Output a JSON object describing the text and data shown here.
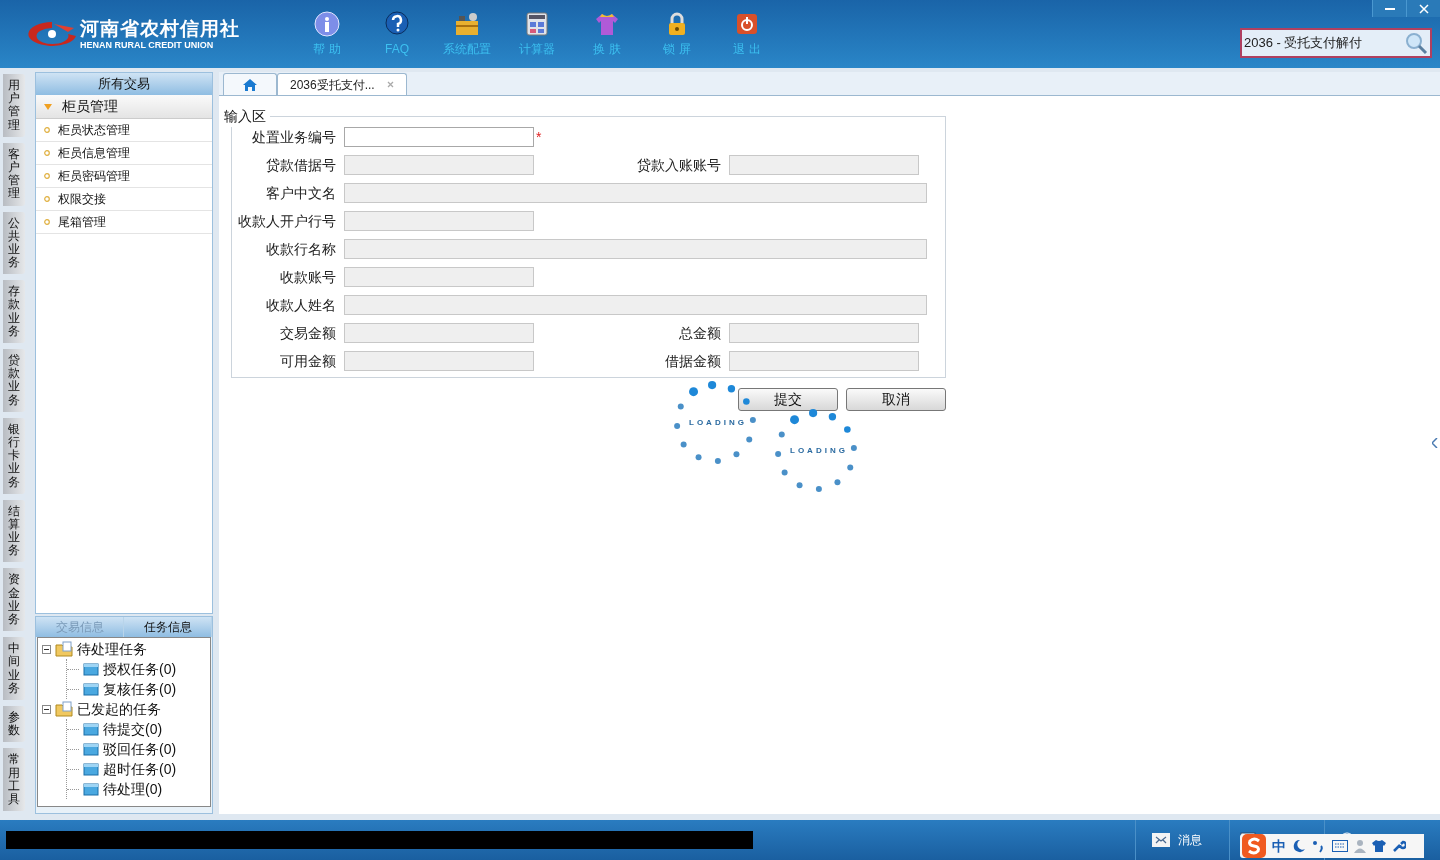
{
  "header": {
    "logo_cn": "河南省农村信用社",
    "logo_en": "HENAN RURAL CREDIT UNION",
    "toolbar": [
      {
        "kind": "info",
        "label": "帮 助"
      },
      {
        "kind": "faq",
        "label": "FAQ"
      },
      {
        "kind": "config",
        "label": "系统配置"
      },
      {
        "kind": "calc",
        "label": "计算器"
      },
      {
        "kind": "skin",
        "label": "换 肤"
      },
      {
        "kind": "lock",
        "label": "锁 屏"
      },
      {
        "kind": "exit",
        "label": "退 出"
      }
    ],
    "search": {
      "value": "2036 - 受托支付解付"
    }
  },
  "side_tabs": [
    {
      "label": "用户管理"
    },
    {
      "label": "客户管理"
    },
    {
      "label": "公共业务"
    },
    {
      "label": "存款业务"
    },
    {
      "label": "贷款业务"
    },
    {
      "label": "银行卡业务"
    },
    {
      "label": "结算业务"
    },
    {
      "label": "资金业务"
    },
    {
      "label": "中间业务"
    },
    {
      "label": "参数"
    },
    {
      "label": "常用工具"
    }
  ],
  "menu": {
    "title": "所有交易",
    "group": {
      "label": "柜员管理",
      "expanded": true
    },
    "items": [
      "柜员状态管理",
      "柜员信息管理",
      "柜员密码管理",
      "权限交接",
      "尾箱管理"
    ]
  },
  "info_tabs": [
    {
      "label": "交易信息",
      "selected": false
    },
    {
      "label": "任务信息",
      "selected": true
    }
  ],
  "tree": [
    {
      "label": "待处理任务",
      "expanded": true,
      "children": [
        {
          "label": "授权任务(0)"
        },
        {
          "label": "复核任务(0)"
        }
      ]
    },
    {
      "label": "已发起的任务",
      "expanded": true,
      "children": [
        {
          "label": "待提交(0)"
        },
        {
          "label": "驳回任务(0)"
        },
        {
          "label": "超时任务(0)"
        },
        {
          "label": "待处理(0)"
        }
      ]
    }
  ],
  "doc_tabs": [
    {
      "kind": "home",
      "selected": false
    },
    {
      "kind": "page",
      "label": "2036受托支付...",
      "selected": true
    }
  ],
  "form": {
    "legend": "输入区",
    "rows": [
      [
        {
          "label": "处置业务编号",
          "kind": "short",
          "disabled": false,
          "required_mark": "*"
        }
      ],
      [
        {
          "label": "贷款借据号",
          "kind": "short",
          "disabled": true
        },
        {
          "label": "贷款入账账号",
          "kind": "short",
          "disabled": true
        }
      ],
      [
        {
          "label": "客户中文名",
          "kind": "long",
          "disabled": true
        }
      ],
      [
        {
          "label": "收款人开户行号",
          "kind": "short",
          "disabled": true
        }
      ],
      [
        {
          "label": "收款行名称",
          "kind": "long",
          "disabled": true
        }
      ],
      [
        {
          "label": "收款账号",
          "kind": "short",
          "disabled": true
        }
      ],
      [
        {
          "label": "收款人姓名",
          "kind": "long",
          "disabled": true
        }
      ],
      [
        {
          "label": "交易金额",
          "kind": "short",
          "disabled": true
        },
        {
          "label": "总金额",
          "kind": "short",
          "disabled": true
        }
      ],
      [
        {
          "label": "可用金额",
          "kind": "short",
          "disabled": true
        },
        {
          "label": "借据金额",
          "kind": "short",
          "disabled": true
        }
      ]
    ],
    "buttons": [
      "提交",
      "取消"
    ]
  },
  "loaders": [
    {
      "label": "LOADING"
    },
    {
      "label": "LOADING"
    }
  ],
  "status_bar": {
    "message": "消息",
    "ime": "中"
  }
}
